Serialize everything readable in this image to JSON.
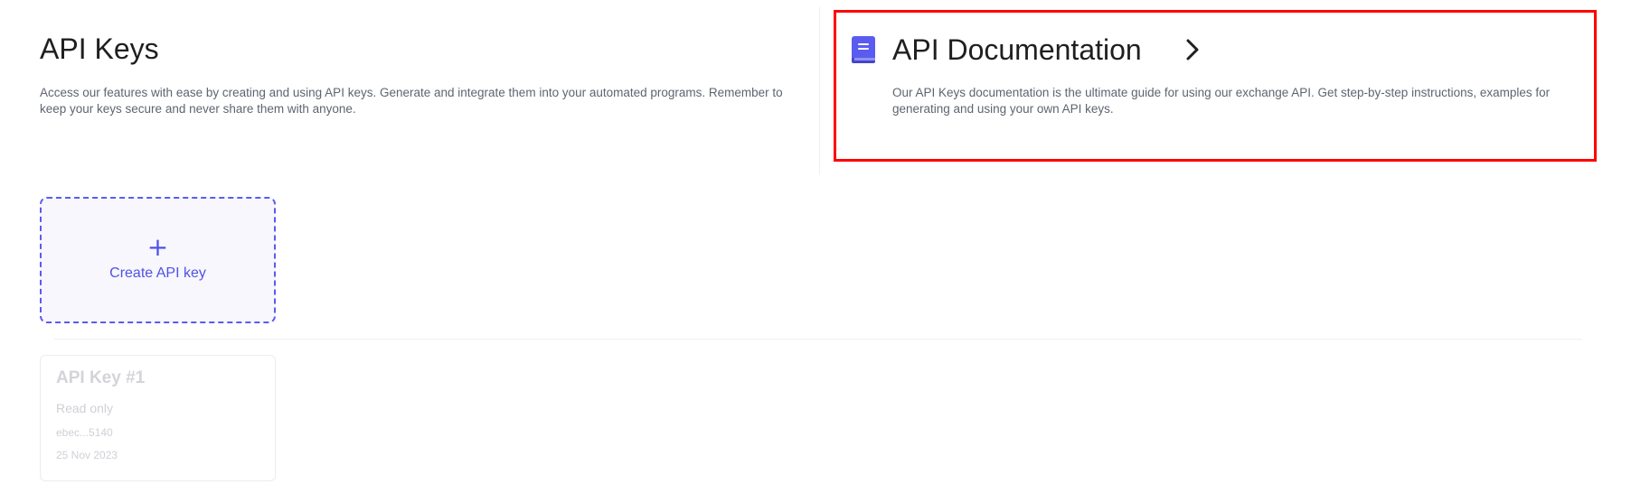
{
  "header": {
    "title": "API Keys",
    "description": "Access our features with ease by creating and using API keys. Generate and integrate them into your automated programs. Remember to keep your keys secure and never share them with anyone."
  },
  "documentation": {
    "icon": "book-icon",
    "title": "API Documentation",
    "chevron_icon": "chevron-right-icon",
    "description": "Our API Keys documentation is the ultimate guide for using our exchange API. Get step-by-step instructions, examples for generating and using your own API keys."
  },
  "create_key": {
    "icon": "plus-icon",
    "plus": "+",
    "label": "Create API key"
  },
  "api_keys": [
    {
      "name": "API Key #1",
      "permission": "Read only",
      "key_id": "ebec...5140",
      "created": "25 Nov 2023"
    }
  ],
  "colors": {
    "accent": "#4f52e8",
    "highlight_border": "#ff0000",
    "icon_bg": "#5a5cf0",
    "muted_text": "#cfd0d6"
  }
}
